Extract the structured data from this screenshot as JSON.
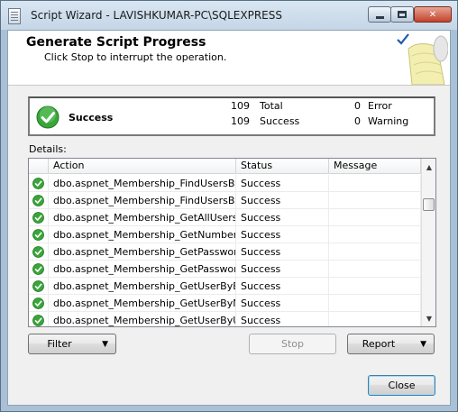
{
  "window": {
    "title": "Script Wizard - LAVISHKUMAR-PC\\SQLEXPRESS"
  },
  "header": {
    "title": "Generate Script Progress",
    "subtitle": "Click Stop to interrupt the operation."
  },
  "summary": {
    "status": "Success",
    "total_value": "109",
    "total_label": "Total",
    "success_value": "109",
    "success_label": "Success",
    "error_value": "0",
    "error_label": "Error",
    "warning_value": "0",
    "warning_label": "Warning"
  },
  "details": {
    "label": "Details:",
    "columns": [
      "Action",
      "Status",
      "Message"
    ],
    "rows": [
      {
        "action": "dbo.aspnet_Membership_FindUsersBy...",
        "status": "Success",
        "message": ""
      },
      {
        "action": "dbo.aspnet_Membership_FindUsersBy...",
        "status": "Success",
        "message": ""
      },
      {
        "action": "dbo.aspnet_Membership_GetAllUsers",
        "status": "Success",
        "message": ""
      },
      {
        "action": "dbo.aspnet_Membership_GetNumber...",
        "status": "Success",
        "message": ""
      },
      {
        "action": "dbo.aspnet_Membership_GetPassword",
        "status": "Success",
        "message": ""
      },
      {
        "action": "dbo.aspnet_Membership_GetPasswor...",
        "status": "Success",
        "message": ""
      },
      {
        "action": "dbo.aspnet_Membership_GetUserByE...",
        "status": "Success",
        "message": ""
      },
      {
        "action": "dbo.aspnet_Membership_GetUserByN...",
        "status": "Success",
        "message": ""
      },
      {
        "action": "dbo.aspnet_Membership_GetUserByU...",
        "status": "Success",
        "message": ""
      }
    ]
  },
  "buttons": {
    "filter": "Filter",
    "stop": "Stop",
    "report": "Report",
    "close": "Close"
  },
  "icons": {
    "status": "success-check-icon",
    "window": "script-document-icon",
    "header_art": "scroll-with-checkmark-icon"
  },
  "colors": {
    "success_green": "#3aa53a",
    "window_frame": "#a9c0d6"
  }
}
